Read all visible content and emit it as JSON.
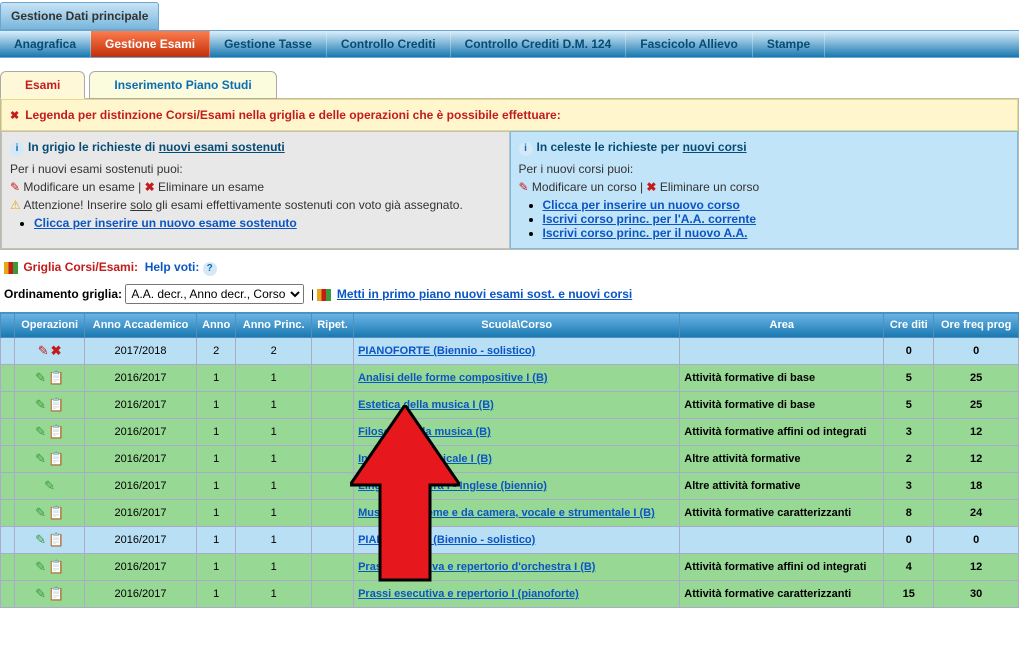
{
  "window_title": "Gestione Dati principale",
  "nav": {
    "anagrafica": "Anagrafica",
    "gestione_esami": "Gestione Esami",
    "gestione_tasse": "Gestione Tasse",
    "controllo_crediti": "Controllo Crediti",
    "controllo_dm124": "Controllo Crediti D.M. 124",
    "fascicolo": "Fascicolo Allievo",
    "stampe": "Stampe"
  },
  "subtabs": {
    "esami": "Esami",
    "piano": "Inserimento Piano Studi"
  },
  "legend": "Legenda per distinzione Corsi/Esami nella griglia e delle operazioni che è possibile effettuare:",
  "col_grey": {
    "title_prefix": "In grigio le richieste di ",
    "title_link": "nuovi esami sostenuti",
    "p1": "Per i nuovi esami sostenuti puoi:",
    "mod": "Modificare un esame",
    "elim": "Eliminare un esame",
    "att_pre": "Attenzione! Inserire ",
    "att_u": "solo",
    "att_post": " gli esami effettivamente sostenuti con voto già assegnato.",
    "link": "Clicca per inserire un nuovo esame sostenuto"
  },
  "col_blue": {
    "title_prefix": "In celeste le richieste per ",
    "title_link": "nuovi corsi",
    "p1": "Per i nuovi corsi puoi:",
    "mod": "Modificare un corso",
    "elim": "Eliminare un corso",
    "l1": "Clicca per inserire un nuovo corso",
    "l2": "Iscrivi corso princ. per l'A.A. corrente",
    "l3": "Iscrivi corso princ. per il nuovo A.A."
  },
  "griglia": {
    "label": "Griglia Corsi/Esami:",
    "help": "Help voti:"
  },
  "ordinamento": {
    "label": "Ordinamento griglia:",
    "selected": "A.A. decr., Anno decr., Corso",
    "primo": "Metti in primo piano nuovi esami sost. e nuovi corsi"
  },
  "headers": {
    "op": "Operazioni",
    "aa": "Anno Accademico",
    "anno": "Anno",
    "annop": "Anno Princ.",
    "rip": "Ripet.",
    "corso": "Scuola\\Corso",
    "area": "Area",
    "cre": "Cre diti",
    "ore": "Ore freq prog"
  },
  "rows": [
    {
      "type": "blue",
      "ops": "edit-del",
      "aa": "2017/2018",
      "anno": "2",
      "annop": "2",
      "corso": "PIANOFORTE (Biennio - solistico)",
      "area": "",
      "cre": "0",
      "ore": "0"
    },
    {
      "type": "green",
      "ops": "gp-note",
      "aa": "2016/2017",
      "anno": "1",
      "annop": "1",
      "corso": "Analisi delle forme compositive I   (B)",
      "area": "Attività formative di base",
      "cre": "5",
      "ore": "25"
    },
    {
      "type": "green",
      "ops": "gp-note",
      "aa": "2016/2017",
      "anno": "1",
      "annop": "1",
      "corso": "Estetica della musica I   (B)",
      "area": "Attività formative di base",
      "cre": "5",
      "ore": "25"
    },
    {
      "type": "green",
      "ops": "gp-note",
      "aa": "2016/2017",
      "anno": "1",
      "annop": "1",
      "corso": "Filosofia della musica   (B)",
      "area": "Attività formative affini od integrati",
      "cre": "3",
      "ore": "12"
    },
    {
      "type": "green",
      "ops": "gp-note",
      "aa": "2016/2017",
      "anno": "1",
      "annop": "1",
      "corso": "Informatica musicale I   (B)",
      "area": "Altre attività formative",
      "cre": "2",
      "ore": "12"
    },
    {
      "type": "green",
      "ops": "gp",
      "aa": "2016/2017",
      "anno": "1",
      "annop": "1",
      "corso": "Lingua straniera I - Inglese (biennio)",
      "area": "Altre attività formative",
      "cre": "3",
      "ore": "18"
    },
    {
      "type": "green",
      "ops": "gp-note",
      "aa": "2016/2017",
      "anno": "1",
      "annop": "1",
      "corso": "Musica d'insieme e da camera, vocale e strumentale I   (B)",
      "area": "Attività formative caratterizzanti",
      "cre": "8",
      "ore": "24"
    },
    {
      "type": "blue",
      "ops": "gp-note",
      "aa": "2016/2017",
      "anno": "1",
      "annop": "1",
      "corso": "PIANOFORTE (Biennio - solistico)",
      "area": "",
      "cre": "0",
      "ore": "0"
    },
    {
      "type": "green",
      "ops": "gp-note",
      "aa": "2016/2017",
      "anno": "1",
      "annop": "1",
      "corso": "Prassi esecutiva e repertorio d'orchestra I   (B)",
      "area": "Attività formative affini od integrati",
      "cre": "4",
      "ore": "12"
    },
    {
      "type": "green",
      "ops": "gp-note",
      "aa": "2016/2017",
      "anno": "1",
      "annop": "1",
      "corso": "Prassi esecutiva e repertorio I (pianoforte)",
      "area": "Attività formative caratterizzanti",
      "cre": "15",
      "ore": "30"
    }
  ]
}
